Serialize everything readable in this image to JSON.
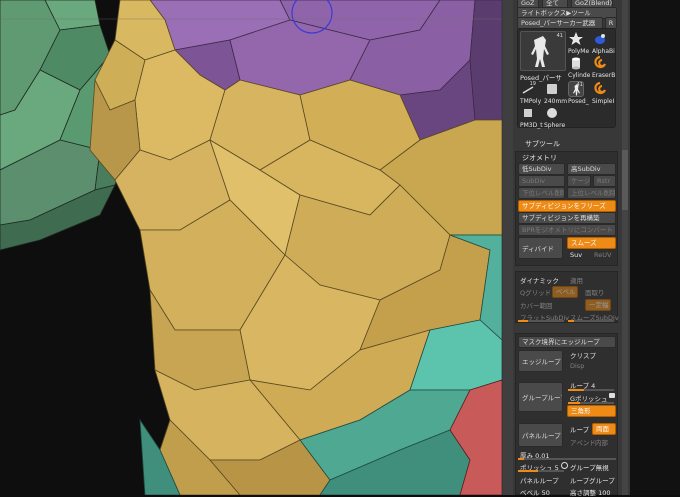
{
  "header": {
    "row1_left": "GoZ",
    "row1_mid": "全て",
    "row1_right": "GoZ(Blend)",
    "lightbox_tool": "ライトボックス▶ツール",
    "current_tool": "Posed_パーサーカー武器",
    "r_button": "R"
  },
  "tools": {
    "main_thumb_label": "Posed_パーサ",
    "main_thumb_count": "41",
    "items": [
      {
        "label": "PolyMe",
        "count": ""
      },
      {
        "label": "AlphaBi",
        "count": ""
      },
      {
        "label": "Cylinde",
        "count": ""
      },
      {
        "label": "EraserB",
        "count": ""
      },
      {
        "label": "TMPoly",
        "count": "19"
      },
      {
        "label": "240mm",
        "count": ""
      },
      {
        "label": "Posed_",
        "count": "41"
      },
      {
        "label": "SimpleI",
        "count": ""
      },
      {
        "label": "PM3D_t",
        "count": ""
      },
      {
        "label": "Sphere",
        "count": ""
      }
    ]
  },
  "subtool": {
    "label": "サブツール"
  },
  "geometry": {
    "title": "ジオメトリ",
    "low_subdiv": "低SubDiv",
    "high_subdiv": "高SubDiv",
    "subdiv": "SubDiv",
    "cage": "ケージ",
    "rstr": "Rstr",
    "del_lower": "下位レベル削除",
    "del_higher": "上位レベル削除",
    "freeze_subdiv": "サブディビジョンをフリーズ",
    "reconstruct_subdiv": "サブディビジョンを再構築",
    "convert_bpr": "BPRをジオメトリにコンバート",
    "divide": "ディバイド",
    "smooth": "スムーズ",
    "suv": "Suv",
    "reuv": "ReUV"
  },
  "dynamic": {
    "title": "ダイナミック",
    "apply": "適用",
    "q_grid": "Qグリッド",
    "bevel": "ベベル",
    "round": "面取り",
    "coverage": "カバー範囲",
    "constant": "一定幅",
    "flat_subdiv": "フラットSubDiv",
    "smooth_subdiv": "スムーズSubDiv"
  },
  "edgeloop": {
    "edge_loop_mask_border": "マスク境界にエッジループ",
    "edge_loop": "エッジループ",
    "crease": "クリスプ",
    "disp": "Disp",
    "group_loop": "グループループ",
    "loops": "ループ 4",
    "g_polish": "Gポリッシュ",
    "g_polish_icon": "camera-icon",
    "triangles": "三角形",
    "panel_loop": "パネルループ",
    "loop": "ループ",
    "double": "両面",
    "append": "アペンド",
    "inner": "内部",
    "thickness": "厚み 0.01",
    "polish": "ポリッシュ 5",
    "group_ignore": "グループ無視",
    "panel_loop2": "パネルループ",
    "loop_group": "ループグループ",
    "bevel50": "ベベル 50",
    "elevation": "高さ調整 100"
  },
  "colors": {
    "accent": "#ee8a16",
    "panel": "#383838",
    "mesh_yellow": "#d7b45f",
    "mesh_purple": "#8f64aa",
    "mesh_green": "#6aa87e",
    "mesh_teal": "#5cc4ad",
    "mesh_red": "#c85a5a"
  }
}
